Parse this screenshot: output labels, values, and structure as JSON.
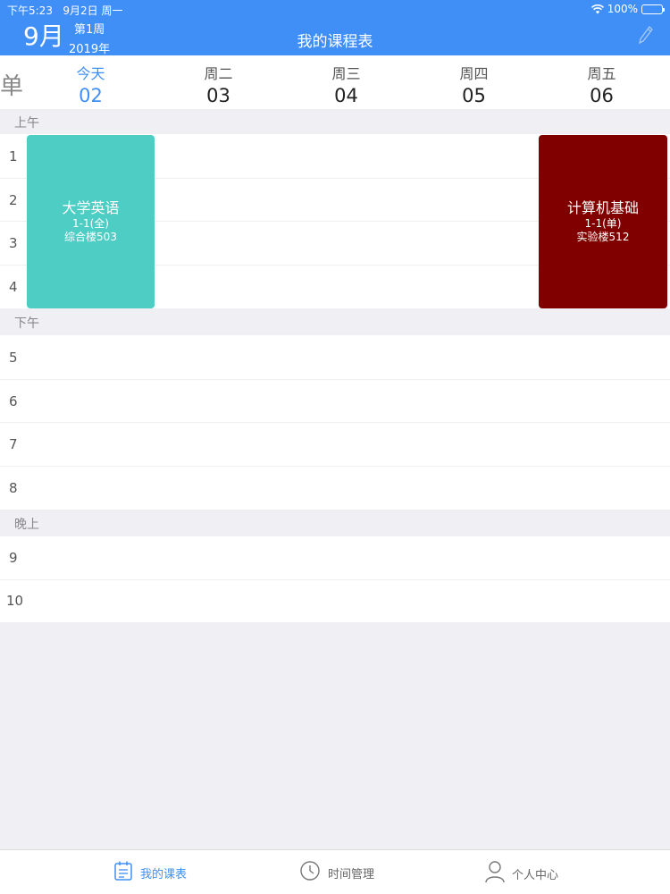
{
  "status_bar": {
    "time": "下午5:23",
    "date": "9月2日 周一",
    "battery": "100%"
  },
  "header": {
    "month": "9月",
    "week": "第1周",
    "year": "2019年",
    "title": "我的课程表",
    "edit_icon": "pencil-icon"
  },
  "week_mode": "单",
  "days": [
    {
      "name": "今天",
      "date": "02"
    },
    {
      "name": "周二",
      "date": "03"
    },
    {
      "name": "周三",
      "date": "04"
    },
    {
      "name": "周四",
      "date": "05"
    },
    {
      "name": "周五",
      "date": "06"
    }
  ],
  "sections": {
    "morning": "上午",
    "afternoon": "下午",
    "evening": "晚上"
  },
  "periods": [
    "1",
    "2",
    "3",
    "4",
    "5",
    "6",
    "7",
    "8",
    "9",
    "10"
  ],
  "courses": [
    {
      "name": "大学英语",
      "weeks": "1-1(全)",
      "room": "综合楼503",
      "color": "#4ecdc4"
    },
    {
      "name": "计算机基础",
      "weeks": "1-1(单)",
      "room": "实验楼512",
      "color": "#800000"
    }
  ],
  "tabs": [
    {
      "label": "我的课表",
      "icon": "calendar-icon"
    },
    {
      "label": "时间管理",
      "icon": "clock-icon"
    },
    {
      "label": "个人中心",
      "icon": "person-icon"
    }
  ],
  "colors": {
    "brand": "#3f8ff7",
    "background": "#efeff4"
  }
}
